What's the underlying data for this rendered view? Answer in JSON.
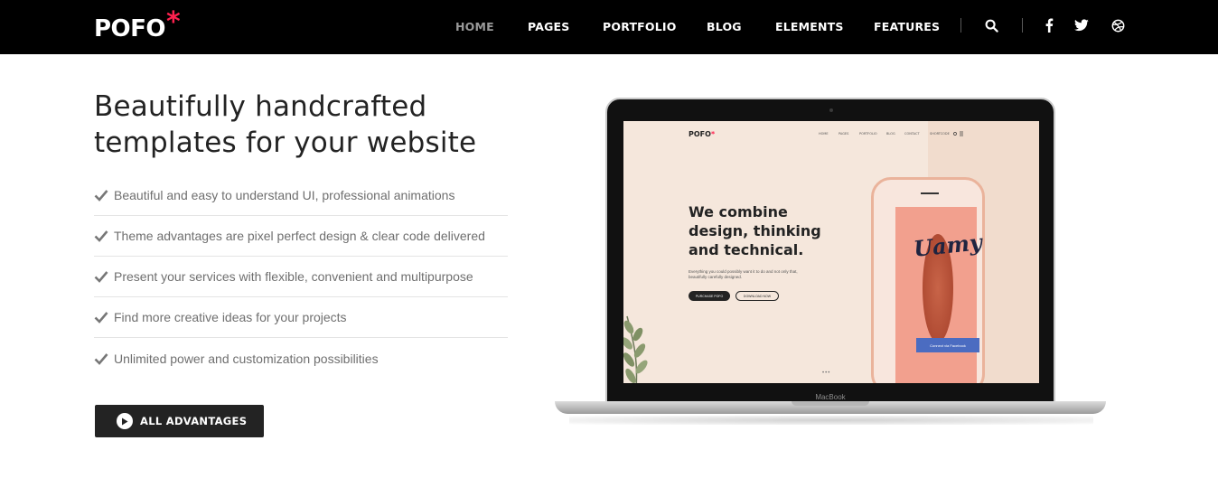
{
  "nav": {
    "logo": "POFO",
    "logo_star": "*",
    "menu": [
      "HOME",
      "PAGES",
      "PORTFOLIO",
      "BLOG",
      "ELEMENTS",
      "FEATURES"
    ],
    "active": "HOME",
    "icons": [
      "search-icon",
      "facebook-icon",
      "twitter-icon",
      "dribbble-icon"
    ]
  },
  "hero": {
    "headline_line1": "Beautifully handcrafted",
    "headline_line2": "templates for your website",
    "features": [
      "Beautiful and easy to understand UI, professional animations",
      "Theme advantages are pixel perfect design & clear code delivered",
      "Present your services with flexible, convenient and multipurpose",
      "Find more creative ideas for your projects",
      "Unlimited power and customization possibilities"
    ],
    "cta_label": "ALL ADVANTAGES"
  },
  "mockup": {
    "logo": "POFO",
    "logo_star": "*",
    "menu": [
      "HOME",
      "PAGES",
      "PORTFOLIO",
      "BLOG",
      "CONTACT",
      "SHORTCODE"
    ],
    "headline": [
      "We combine",
      "design, thinking",
      "and technical."
    ],
    "sub": "Everything you could possibly want it to do and not only that, beautifully carefully designed.",
    "btn_primary": "PURCHASE POFO",
    "btn_secondary": "DOWNLOAD NOW",
    "phone_brand": "Uamy",
    "fb_button": "Connect via Facebook",
    "device_label": "MacBook"
  },
  "colors": {
    "accent": "#ff214f",
    "dark": "#232323",
    "nav_bg": "#000000"
  }
}
